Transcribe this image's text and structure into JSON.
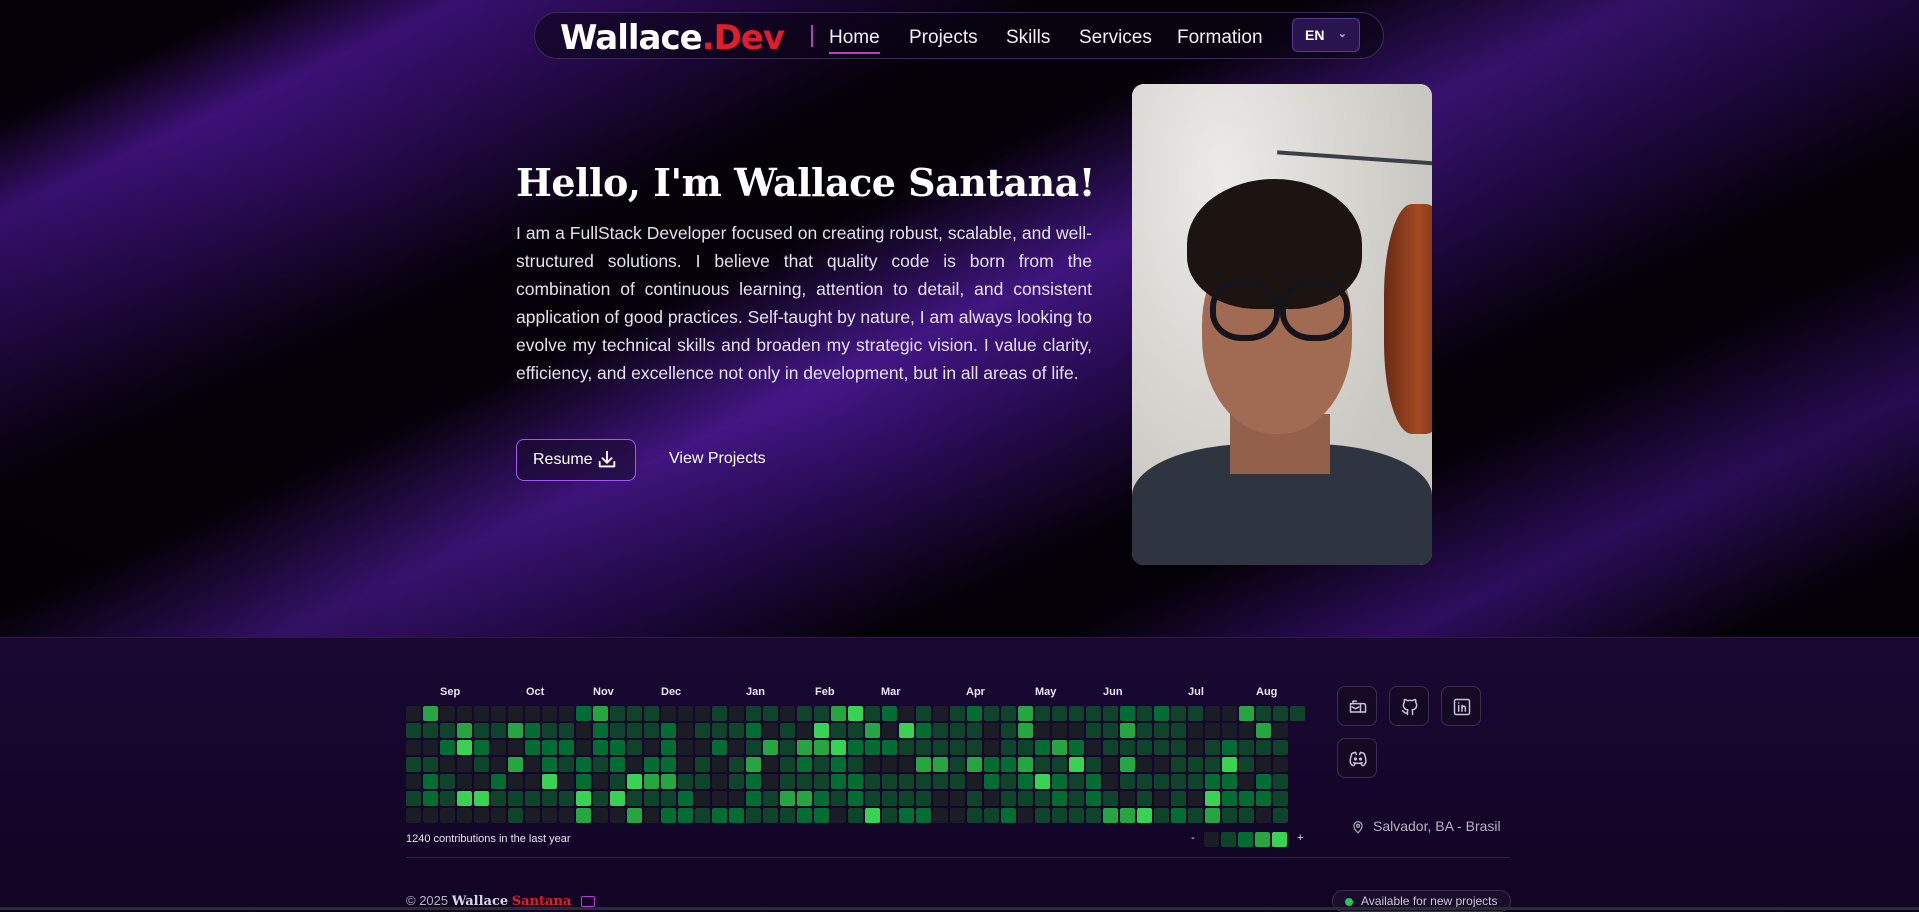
{
  "brand": {
    "logo_main": "Wallace",
    "logo_accent": ".Dev"
  },
  "nav": {
    "links": [
      "Home",
      "Projects",
      "Skills",
      "Services",
      "Formation"
    ],
    "active": "Home",
    "language": "EN"
  },
  "hero": {
    "title": "Hello, I'm Wallace Santana!",
    "text": "I am a FullStack Developer focused on creating robust, scalable, and well-structured solutions. I believe that quality code is born from the combination of continuous learning, attention to detail, and consistent application of good practices. Self-taught by nature, I am always looking to evolve my technical skills and broaden my strategic vision. I value clarity, efficiency, and excellence not only in development, but in all areas of life.",
    "resume_label": "Resume",
    "projects_label": "View Projects"
  },
  "contributions": {
    "months": [
      "Sep",
      "Oct",
      "Nov",
      "Dec",
      "Jan",
      "Feb",
      "Mar",
      "Apr",
      "May",
      "Jun",
      "Jul",
      "Aug"
    ],
    "summary": "1240 contributions in the last year",
    "legend_less": "-",
    "legend_more": "+",
    "colors": [
      "#1b1d24",
      "#0e4429",
      "#006d32",
      "#26a641",
      "#39d353"
    ]
  },
  "social": [
    "mail-icon",
    "github-icon",
    "linkedin-icon",
    "discord-icon"
  ],
  "footer": {
    "location": "Salvador, BA - Brasil",
    "copyright_prefix": "© 2025",
    "copyright_name": "Wallace",
    "copyright_accent": "Santana",
    "status": "Available for new projects"
  }
}
